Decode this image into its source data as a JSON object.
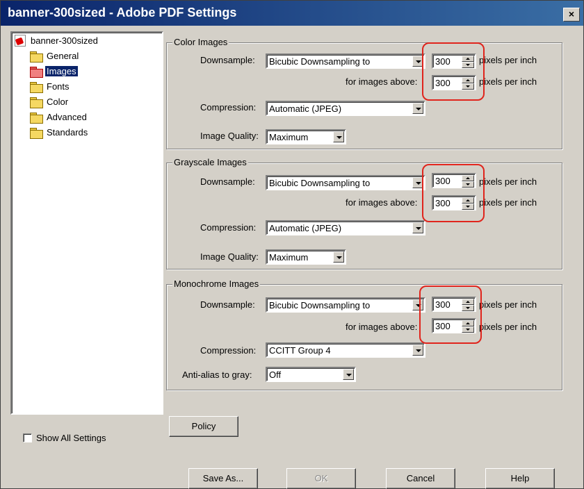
{
  "window": {
    "title": "banner-300sized - Adobe PDF Settings",
    "close_label": "×"
  },
  "tree": {
    "root": "banner-300sized",
    "items": [
      "General",
      "Images",
      "Fonts",
      "Color",
      "Advanced",
      "Standards"
    ],
    "selected": "Images"
  },
  "show_all_settings": {
    "label": "Show All Settings",
    "checked": false
  },
  "color_images": {
    "title": "Color Images",
    "downsample_label": "Downsample:",
    "downsample_value": "Bicubic Downsampling to",
    "ppi_value": "300",
    "ppi_unit": "pixels per inch",
    "above_label": "for images above:",
    "above_value": "300",
    "above_unit": "pixels per inch",
    "compression_label": "Compression:",
    "compression_value": "Automatic (JPEG)",
    "quality_label": "Image Quality:",
    "quality_value": "Maximum"
  },
  "grayscale_images": {
    "title": "Grayscale Images",
    "downsample_label": "Downsample:",
    "downsample_value": "Bicubic Downsampling to",
    "ppi_value": "300",
    "ppi_unit": "pixels per inch",
    "above_label": "for images above:",
    "above_value": "300",
    "above_unit": "pixels per inch",
    "compression_label": "Compression:",
    "compression_value": "Automatic (JPEG)",
    "quality_label": "Image Quality:",
    "quality_value": "Maximum"
  },
  "monochrome_images": {
    "title": "Monochrome Images",
    "downsample_label": "Downsample:",
    "downsample_value": "Bicubic Downsampling to",
    "ppi_value": "300",
    "ppi_unit": "pixels per inch",
    "above_label": "for images above:",
    "above_value": "300",
    "above_unit": "pixels per inch",
    "compression_label": "Compression:",
    "compression_value": "CCITT Group 4",
    "antialias_label": "Anti-alias to gray:",
    "antialias_value": "Off"
  },
  "buttons": {
    "policy": "Policy",
    "save_as": "Save As...",
    "ok": "OK",
    "cancel": "Cancel",
    "help": "Help"
  },
  "colors": {
    "titlebar": "#0a246a",
    "dialog_bg": "#d4d0c8",
    "annotation": "#e0241c"
  }
}
